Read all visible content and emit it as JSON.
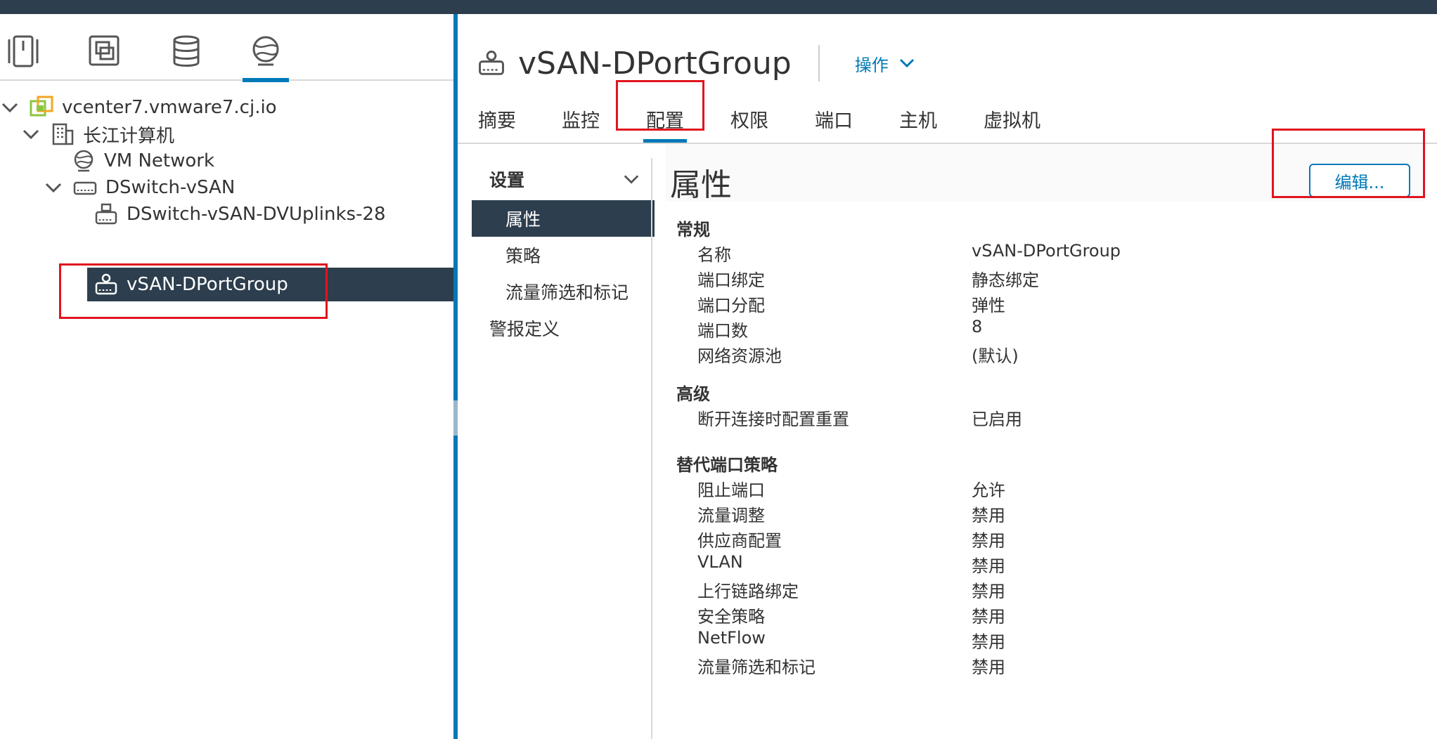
{
  "navigator": {
    "tabs": [
      {
        "name": "hosts-clusters-icon"
      },
      {
        "name": "vms-templates-icon"
      },
      {
        "name": "storage-icon"
      },
      {
        "name": "networking-icon",
        "active": true
      }
    ],
    "tree": [
      {
        "label": "vcenter7.vmware7.cj.io",
        "icon": "vcenter-icon",
        "expanded": true
      },
      {
        "label": "长江计算机",
        "icon": "datacenter-icon",
        "expanded": true
      },
      {
        "label": "VM Network",
        "icon": "network-icon"
      },
      {
        "label": "DSwitch-vSAN",
        "icon": "dswitch-icon",
        "expanded": true
      },
      {
        "label": "DSwitch-vSAN-DVUplinks-28",
        "icon": "uplink-portgroup-icon"
      },
      {
        "label": "vSAN-DPortGroup",
        "icon": "portgroup-icon",
        "selected": true
      }
    ]
  },
  "header": {
    "title": "vSAN-DPortGroup",
    "actions_label": "操作"
  },
  "tabs": [
    "摘要",
    "监控",
    "配置",
    "权限",
    "端口",
    "主机",
    "虚拟机"
  ],
  "active_tab": "配置",
  "subnav": {
    "group_label": "设置",
    "items": [
      "属性",
      "策略",
      "流量筛选和标记"
    ],
    "alarm_label": "警报定义"
  },
  "content": {
    "title": "属性",
    "edit_label": "编辑...",
    "sections": [
      {
        "title": "常规",
        "rows": [
          {
            "label": "名称",
            "value": "vSAN-DPortGroup"
          },
          {
            "label": "端口绑定",
            "value": "静态绑定"
          },
          {
            "label": "端口分配",
            "value": "弹性"
          },
          {
            "label": "端口数",
            "value": "8"
          },
          {
            "label": "网络资源池",
            "value": "(默认)"
          }
        ]
      },
      {
        "title": "高级",
        "rows": [
          {
            "label": "断开连接时配置重置",
            "value": "已启用"
          }
        ]
      },
      {
        "title": "替代端口策略",
        "rows": [
          {
            "label": "阻止端口",
            "value": "允许"
          },
          {
            "label": "流量调整",
            "value": "禁用"
          },
          {
            "label": "供应商配置",
            "value": "禁用"
          },
          {
            "label": "VLAN",
            "value": "禁用"
          },
          {
            "label": "上行链路绑定",
            "value": "禁用"
          },
          {
            "label": "安全策略",
            "value": "禁用"
          },
          {
            "label": "NetFlow",
            "value": "禁用"
          },
          {
            "label": "流量筛选和标记",
            "value": "禁用"
          }
        ]
      }
    ]
  },
  "colors": {
    "topbar": "#2d3e4e",
    "accent": "#0079b8",
    "selected_bg": "#2d3e4e",
    "highlight": "#e0141e"
  }
}
